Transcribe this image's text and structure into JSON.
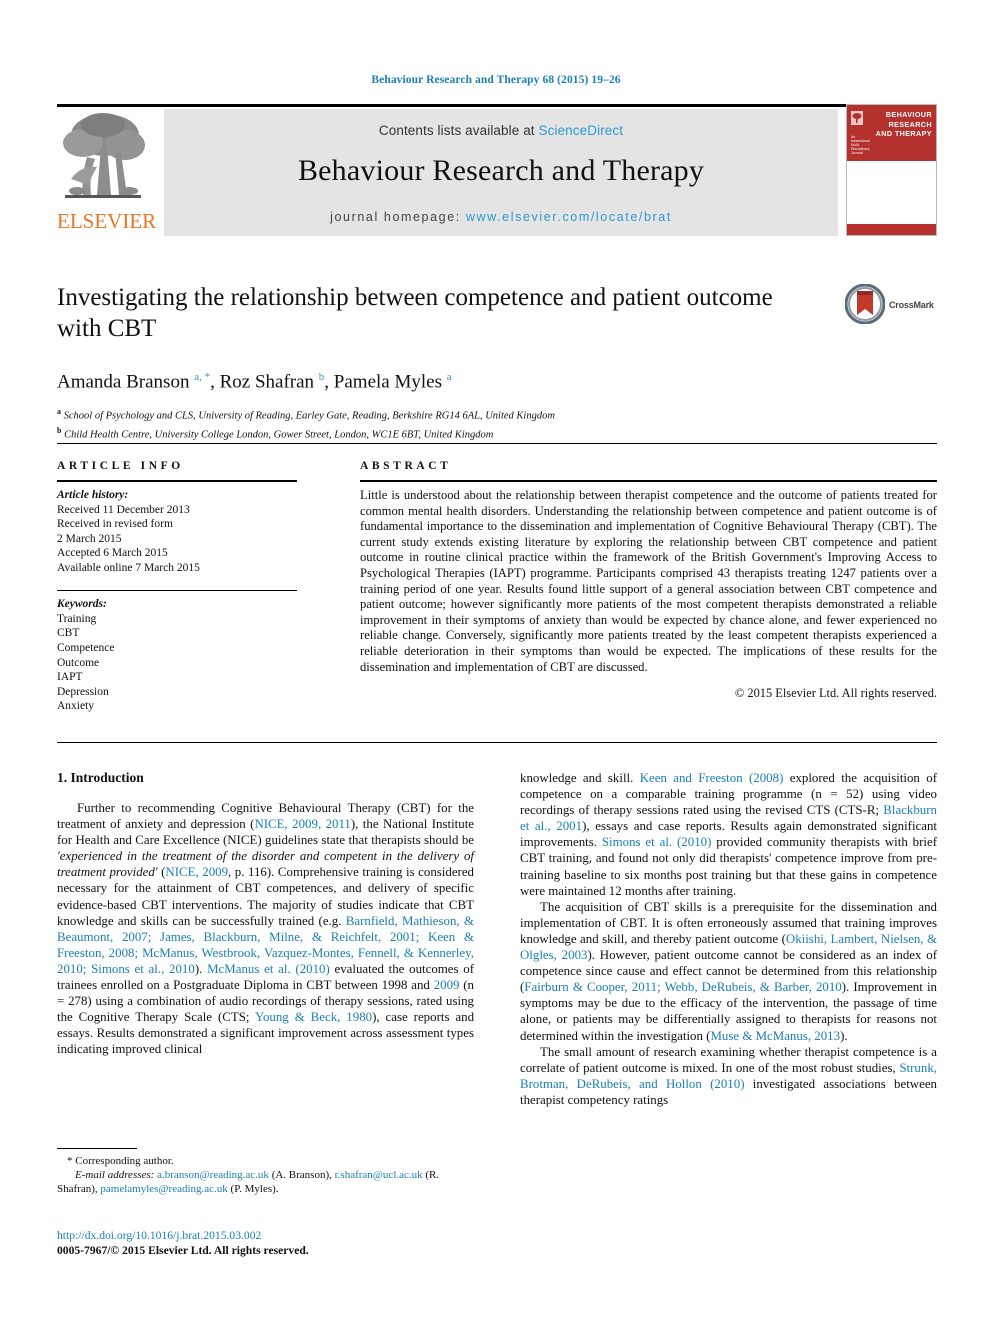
{
  "running_head": "Behaviour Research and Therapy 68 (2015) 19–26",
  "masthead": {
    "contents_prefix": "Contents lists available at ",
    "science_direct": "ScienceDirect",
    "journal_name": "Behaviour Research and Therapy",
    "homepage_prefix": "journal homepage: ",
    "homepage_url": "www.elsevier.com/locate/brat",
    "publisher": "ELSEVIER",
    "cover_title": "BEHAVIOUR RESEARCH AND THERAPY",
    "cover_imprint": "An Intamotonal Multi-Disciplinary Journal"
  },
  "article": {
    "title": "Investigating the relationship between competence and patient outcome with CBT",
    "authors_html": "Amanda Branson <sup>a, *</sup>, Roz Shafran <sup>b</sup>, Pamela Myles <sup>a</sup>",
    "affiliation_a": "School of Psychology and CLS, University of Reading, Earley Gate, Reading, Berkshire RG14 6AL, United Kingdom",
    "affiliation_b": "Child Health Centre, University College London, Gower Street, London, WC1E 6BT, United Kingdom",
    "crossmark_label": "CrossMark"
  },
  "article_info": {
    "heading": "ARTICLE INFO",
    "history_label": "Article history:",
    "history": [
      "Received 11 December 2013",
      "Received in revised form",
      "2 March 2015",
      "Accepted 6 March 2015",
      "Available online 7 March 2015"
    ],
    "keywords_label": "Keywords:",
    "keywords": [
      "Training",
      "CBT",
      "Competence",
      "Outcome",
      "IAPT",
      "Depression",
      "Anxiety"
    ]
  },
  "abstract": {
    "heading": "ABSTRACT",
    "text": "Little is understood about the relationship between therapist competence and the outcome of patients treated for common mental health disorders. Understanding the relationship between competence and patient outcome is of fundamental importance to the dissemination and implementation of Cognitive Behavioural Therapy (CBT). The current study extends existing literature by exploring the relationship between CBT competence and patient outcome in routine clinical practice within the framework of the British Government's Improving Access to Psychological Therapies (IAPT) programme. Participants comprised 43 therapists treating 1247 patients over a training period of one year. Results found little support of a general association between CBT competence and patient outcome; however significantly more patients of the most competent therapists demonstrated a reliable improvement in their symptoms of anxiety than would be expected by chance alone, and fewer experienced no reliable change. Conversely, significantly more patients treated by the least competent therapists experienced a reliable deterioration in their symptoms than would be expected. The implications of these results for the dissemination and implementation of CBT are discussed.",
    "copyright": "© 2015 Elsevier Ltd. All rights reserved."
  },
  "introduction": {
    "heading": "1. Introduction",
    "left_paragraphs": [
      "Further to recommending Cognitive Behavioural Therapy (CBT) for the treatment of anxiety and depression (NICE, 2009, 2011), the National Institute for Health and Care Excellence (NICE) guidelines state that therapists should be 'experienced in the treatment of the disorder and competent in the delivery of treatment provided' (NICE, 2009, p. 116). Comprehensive training is considered necessary for the attainment of CBT competences, and delivery of specific evidence-based CBT interventions. The majority of studies indicate that CBT knowledge and skills can be successfully trained (e.g. Barnfield, Mathieson, & Beaumont, 2007; James, Blackburn, Milne, & Reichfelt, 2001; Keen & Freeston, 2008; McManus, Westbrook, Vazquez-Montes, Fennell, & Kennerley, 2010; Simons et al., 2010). McManus et al. (2010) evaluated the outcomes of trainees enrolled on a Postgraduate Diploma in CBT between 1998 and 2009 (n = 278) using a combination of audio recordings of therapy sessions, rated using the Cognitive Therapy Scale (CTS; Young & Beck, 1980), case reports and essays. Results demonstrated a significant improvement across assessment types indicating improved clinical"
    ],
    "right_paragraphs": [
      "knowledge and skill. Keen and Freeston (2008) explored the acquisition of competence on a comparable training programme (n = 52) using video recordings of therapy sessions rated using the revised CTS (CTS-R; Blackburn et al., 2001), essays and case reports. Results again demonstrated significant improvements. Simons et al. (2010) provided community therapists with brief CBT training, and found not only did therapists' competence improve from pre-training baseline to six months post training but that these gains in competence were maintained 12 months after training.",
      "The acquisition of CBT skills is a prerequisite for the dissemination and implementation of CBT. It is often erroneously assumed that training improves knowledge and skill, and thereby patient outcome (Okiishi, Lambert, Nielsen, & Olgles, 2003). However, patient outcome cannot be considered as an index of competence since cause and effect cannot be determined from this relationship (Fairburn & Cooper, 2011; Webb, DeRubeis, & Barber, 2010). Improvement in symptoms may be due to the efficacy of the intervention, the passage of time alone, or patients may be differentially assigned to therapists for reasons not determined within the investigation (Muse & McManus, 2013).",
      "The small amount of research examining whether therapist competence is a correlate of patient outcome is mixed. In one of the most robust studies, Strunk, Brotman, DeRubeis, and Hollon (2010) investigated associations between therapist competency ratings"
    ]
  },
  "footnote": {
    "corresponding_marker": "*",
    "corresponding_text": "Corresponding author.",
    "email_label": "E-mail addresses:",
    "emails": [
      {
        "address": "a.branson@reading.ac.uk",
        "person": "(A. Branson)"
      },
      {
        "address": "r.shafran@ucl.ac.uk",
        "person": "(R. Shafran)"
      },
      {
        "address": "pamelamyles@reading.ac.uk",
        "person": "(P. Myles)"
      }
    ]
  },
  "doi_block": {
    "doi_url": "http://dx.doi.org/10.1016/j.brat.2015.03.002",
    "issn_line": "0005-7967/© 2015 Elsevier Ltd. All rights reserved."
  },
  "colors": {
    "link_blue": "#1a7fb5",
    "science_direct_blue": "#2c9ad1",
    "elsevier_orange": "#e87722",
    "cover_red": "#b5312e",
    "masthead_gray": "#e4e4e4"
  }
}
